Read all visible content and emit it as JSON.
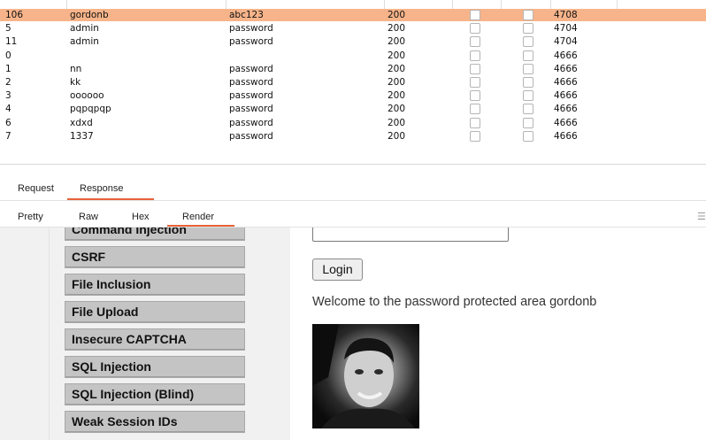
{
  "results": {
    "rows": [
      {
        "request": "106",
        "payload1": "gordonb",
        "payload2": "abc123",
        "status": "200",
        "length": "4708",
        "selected": true
      },
      {
        "request": "5",
        "payload1": "admin",
        "payload2": "password",
        "status": "200",
        "length": "4704"
      },
      {
        "request": "11",
        "payload1": "admin",
        "payload2": "password",
        "status": "200",
        "length": "4704"
      },
      {
        "request": "0",
        "payload1": "",
        "payload2": "",
        "status": "200",
        "length": "4666"
      },
      {
        "request": "1",
        "payload1": "nn",
        "payload2": "password",
        "status": "200",
        "length": "4666"
      },
      {
        "request": "2",
        "payload1": "kk",
        "payload2": "password",
        "status": "200",
        "length": "4666"
      },
      {
        "request": "3",
        "payload1": "oooooo",
        "payload2": "password",
        "status": "200",
        "length": "4666"
      },
      {
        "request": "4",
        "payload1": "pqpqpqp",
        "payload2": "password",
        "status": "200",
        "length": "4666"
      },
      {
        "request": "6",
        "payload1": "xdxd",
        "payload2": "password",
        "status": "200",
        "length": "4666"
      },
      {
        "request": "7",
        "payload1": "1337",
        "payload2": "password",
        "status": "200",
        "length": "4666"
      }
    ]
  },
  "tabs": {
    "request": "Request",
    "response": "Response",
    "active": "Response"
  },
  "view_tabs": {
    "pretty": "Pretty",
    "raw": "Raw",
    "hex": "Hex",
    "render": "Render",
    "active": "Render"
  },
  "render": {
    "menu": [
      "Command Injection",
      "CSRF",
      "File Inclusion",
      "File Upload",
      "Insecure CAPTCHA",
      "SQL Injection",
      "SQL Injection (Blind)",
      "Weak Session IDs"
    ],
    "login_button": "Login",
    "welcome_text": "Welcome to the password protected area gordonb"
  },
  "colors": {
    "selected_row": "#f7b48a",
    "active_tab_underline": "#e8623a",
    "menu_button": "#c4c4c4"
  }
}
